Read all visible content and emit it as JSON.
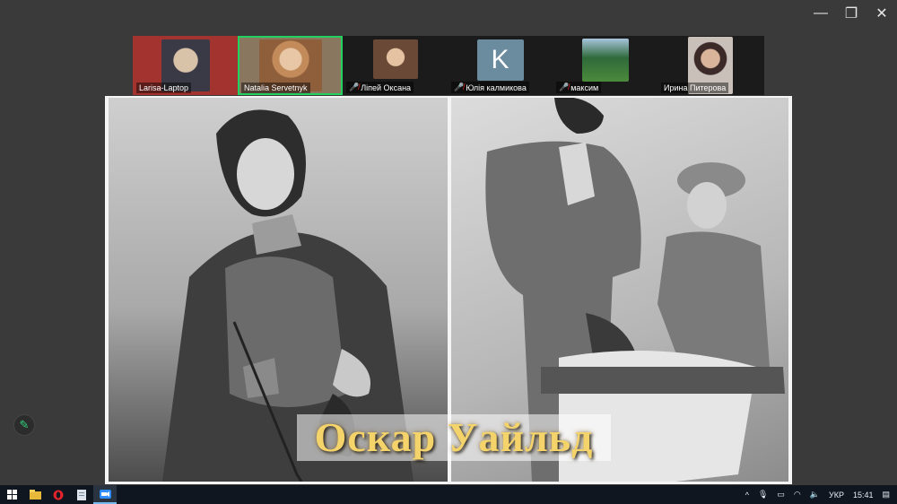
{
  "window_controls": {
    "minimize": "—",
    "restore": "❐",
    "close": "✕"
  },
  "participants": [
    {
      "name": "Larisa-Laptop",
      "muted": false,
      "active": false,
      "kind": "video",
      "bg": "#a3332e"
    },
    {
      "name": "Natalia Servetnyk",
      "muted": false,
      "active": true,
      "kind": "video",
      "bg": "#8a7760"
    },
    {
      "name": "Лiпей Оксана",
      "muted": true,
      "active": false,
      "kind": "video",
      "bg": "#6a4a36"
    },
    {
      "name": "Юлiя калмикова",
      "muted": true,
      "active": false,
      "kind": "letter",
      "letter": "K",
      "bg": "#6b8b9e"
    },
    {
      "name": "максим",
      "muted": true,
      "active": false,
      "kind": "video",
      "bg": "#4b8a3c"
    },
    {
      "name": "Ирина Питерова",
      "muted": false,
      "active": false,
      "kind": "video",
      "bg": "#c9c1b9"
    }
  ],
  "shared_slide": {
    "title": "Оскар Уайльд"
  },
  "taskbar": {
    "start_icon": "windows-start-icon",
    "apps": [
      "file-explorer-icon",
      "opera-icon",
      "notepad-icon",
      "zoom-icon"
    ],
    "tray": {
      "chevron": "^",
      "lang": "УКР",
      "time": "15:41"
    }
  },
  "colors": {
    "active_border": "#23d160",
    "title_gold": "#f5d36b",
    "taskbar": "#0f1620"
  }
}
